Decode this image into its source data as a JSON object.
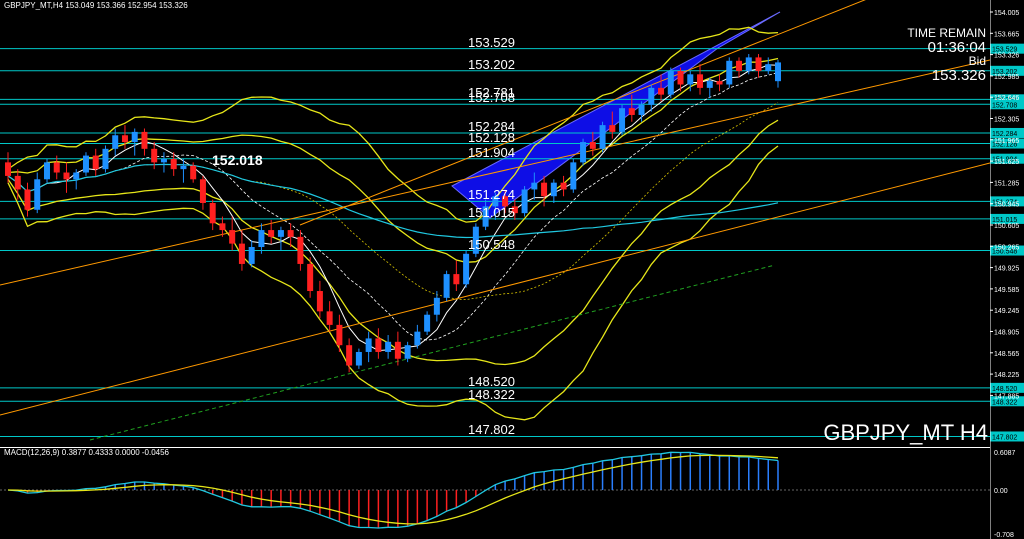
{
  "header": {
    "chart_info": "GBPJPY_MT,H4  153.049 153.366 152.954 153.326"
  },
  "time_remain": {
    "label": "TIME REMAIN",
    "value": "01:36:04",
    "bid_label": "Bid",
    "bid_value": "153.326"
  },
  "symbol_label": "GBPJPY_MT H4",
  "marker_label": "152.018",
  "macd": {
    "header": "MACD(12,26,9) 0.3877 0.4333 0.0000 -0.0456",
    "ticks": [
      "0.6087",
      "0.00",
      "-0.708"
    ]
  },
  "price_axis": {
    "ticks": [
      "154.005",
      "153.665",
      "153.326",
      "152.985",
      "152.646",
      "152.305",
      "151.965",
      "151.625",
      "151.285",
      "150.945",
      "150.605",
      "150.265",
      "149.925",
      "149.585",
      "149.245",
      "148.905",
      "148.565",
      "148.225",
      "147.885"
    ]
  },
  "levels": [
    {
      "label": "153.529",
      "value": 153.529
    },
    {
      "label": "153.202",
      "value": 153.202
    },
    {
      "label": "152.781",
      "value": 152.781
    },
    {
      "label": "152.708",
      "value": 152.708
    },
    {
      "label": "152.284",
      "value": 152.284
    },
    {
      "label": "152.128",
      "value": 152.128
    },
    {
      "label": "151.904",
      "value": 151.904
    },
    {
      "label": "151.274",
      "value": 151.274
    },
    {
      "label": "151.015",
      "value": 151.015
    },
    {
      "label": "150.548",
      "value": 150.548
    },
    {
      "label": "148.520",
      "value": 148.52
    },
    {
      "label": "148.322",
      "value": 148.322
    },
    {
      "label": "147.802",
      "value": 147.802
    }
  ],
  "colors": {
    "background": "#000000",
    "up_candle": "#1e90ff",
    "down_candle": "#ff2020",
    "level_line": "#00c8c8",
    "bands": "#e6e619",
    "trend": "#ff9900",
    "channel_fill": "#1010ff"
  },
  "chart_data": {
    "type": "candlestick",
    "ylim": [
      147.75,
      154.1
    ],
    "candles": [
      [
        151.85,
        152.0,
        151.55,
        151.65
      ],
      [
        151.65,
        151.75,
        151.3,
        151.45
      ],
      [
        151.45,
        151.55,
        151.05,
        151.15
      ],
      [
        151.15,
        151.7,
        151.1,
        151.6
      ],
      [
        151.6,
        151.9,
        151.55,
        151.85
      ],
      [
        151.85,
        151.95,
        151.6,
        151.7
      ],
      [
        151.7,
        151.85,
        151.4,
        151.6
      ],
      [
        151.6,
        151.75,
        151.45,
        151.7
      ],
      [
        151.7,
        152.0,
        151.65,
        151.95
      ],
      [
        151.95,
        152.05,
        151.65,
        151.75
      ],
      [
        151.75,
        152.1,
        151.7,
        152.05
      ],
      [
        152.05,
        152.35,
        151.95,
        152.25
      ],
      [
        152.25,
        152.4,
        152.05,
        152.15
      ],
      [
        152.15,
        152.35,
        151.95,
        152.3
      ],
      [
        152.3,
        152.35,
        151.95,
        152.05
      ],
      [
        152.05,
        152.15,
        151.75,
        151.85
      ],
      [
        151.85,
        152.0,
        151.7,
        151.9
      ],
      [
        151.9,
        152.0,
        151.65,
        151.75
      ],
      [
        151.75,
        151.9,
        151.55,
        151.8
      ],
      [
        151.8,
        151.85,
        151.55,
        151.6
      ],
      [
        151.6,
        151.65,
        151.15,
        151.25
      ],
      [
        151.25,
        151.3,
        150.85,
        150.95
      ],
      [
        150.95,
        151.05,
        150.75,
        150.85
      ],
      [
        150.85,
        151.05,
        150.55,
        150.65
      ],
      [
        150.65,
        150.85,
        150.25,
        150.35
      ],
      [
        150.35,
        150.7,
        150.3,
        150.6
      ],
      [
        150.6,
        150.95,
        150.5,
        150.85
      ],
      [
        150.85,
        151.0,
        150.65,
        150.75
      ],
      [
        150.75,
        150.9,
        150.55,
        150.85
      ],
      [
        150.85,
        150.95,
        150.6,
        150.75
      ],
      [
        150.75,
        150.85,
        150.25,
        150.35
      ],
      [
        150.35,
        150.45,
        149.85,
        149.95
      ],
      [
        149.95,
        150.1,
        149.55,
        149.65
      ],
      [
        149.65,
        149.8,
        149.35,
        149.45
      ],
      [
        149.45,
        149.6,
        149.05,
        149.15
      ],
      [
        149.15,
        149.25,
        148.75,
        148.85
      ],
      [
        148.85,
        149.1,
        148.8,
        149.05
      ],
      [
        149.05,
        149.35,
        148.9,
        149.25
      ],
      [
        149.25,
        149.4,
        148.95,
        149.05
      ],
      [
        149.05,
        149.3,
        148.95,
        149.2
      ],
      [
        149.2,
        149.35,
        148.85,
        148.95
      ],
      [
        148.95,
        149.2,
        148.9,
        149.15
      ],
      [
        149.15,
        149.45,
        149.1,
        149.35
      ],
      [
        149.35,
        149.65,
        149.3,
        149.6
      ],
      [
        149.6,
        149.95,
        149.5,
        149.85
      ],
      [
        149.85,
        150.25,
        149.8,
        150.2
      ],
      [
        150.2,
        150.4,
        149.95,
        150.05
      ],
      [
        150.05,
        150.55,
        150.0,
        150.5
      ],
      [
        150.5,
        150.95,
        150.45,
        150.9
      ],
      [
        150.9,
        151.3,
        150.85,
        151.2
      ],
      [
        151.2,
        151.4,
        151.0,
        151.35
      ],
      [
        151.35,
        151.45,
        151.1,
        151.2
      ],
      [
        151.2,
        151.3,
        151.0,
        151.1
      ],
      [
        151.1,
        151.5,
        151.05,
        151.45
      ],
      [
        151.45,
        151.7,
        151.3,
        151.55
      ],
      [
        151.55,
        151.65,
        151.2,
        151.35
      ],
      [
        151.35,
        151.6,
        151.25,
        151.55
      ],
      [
        151.55,
        151.65,
        151.35,
        151.45
      ],
      [
        151.45,
        151.9,
        151.4,
        151.85
      ],
      [
        151.85,
        152.2,
        151.8,
        152.15
      ],
      [
        152.15,
        152.3,
        151.95,
        152.05
      ],
      [
        152.05,
        152.45,
        152.0,
        152.4
      ],
      [
        152.4,
        152.6,
        152.2,
        152.3
      ],
      [
        152.3,
        152.7,
        152.25,
        152.65
      ],
      [
        152.65,
        152.85,
        152.45,
        152.55
      ],
      [
        152.55,
        152.75,
        152.45,
        152.7
      ],
      [
        152.7,
        153.0,
        152.6,
        152.95
      ],
      [
        152.95,
        153.15,
        152.75,
        152.85
      ],
      [
        152.85,
        153.25,
        152.8,
        153.2
      ],
      [
        153.2,
        153.25,
        152.9,
        153.0
      ],
      [
        153.0,
        153.2,
        152.9,
        153.15
      ],
      [
        153.15,
        153.3,
        152.85,
        152.95
      ],
      [
        152.95,
        153.1,
        152.8,
        153.05
      ],
      [
        153.05,
        153.15,
        152.9,
        153.0
      ],
      [
        153.0,
        153.4,
        152.95,
        153.35
      ],
      [
        153.35,
        153.4,
        153.1,
        153.2
      ],
      [
        153.2,
        153.45,
        153.15,
        153.4
      ],
      [
        153.4,
        153.45,
        153.1,
        153.2
      ],
      [
        153.2,
        153.4,
        153.15,
        153.3
      ],
      [
        153.049,
        153.366,
        152.954,
        153.326
      ]
    ]
  }
}
